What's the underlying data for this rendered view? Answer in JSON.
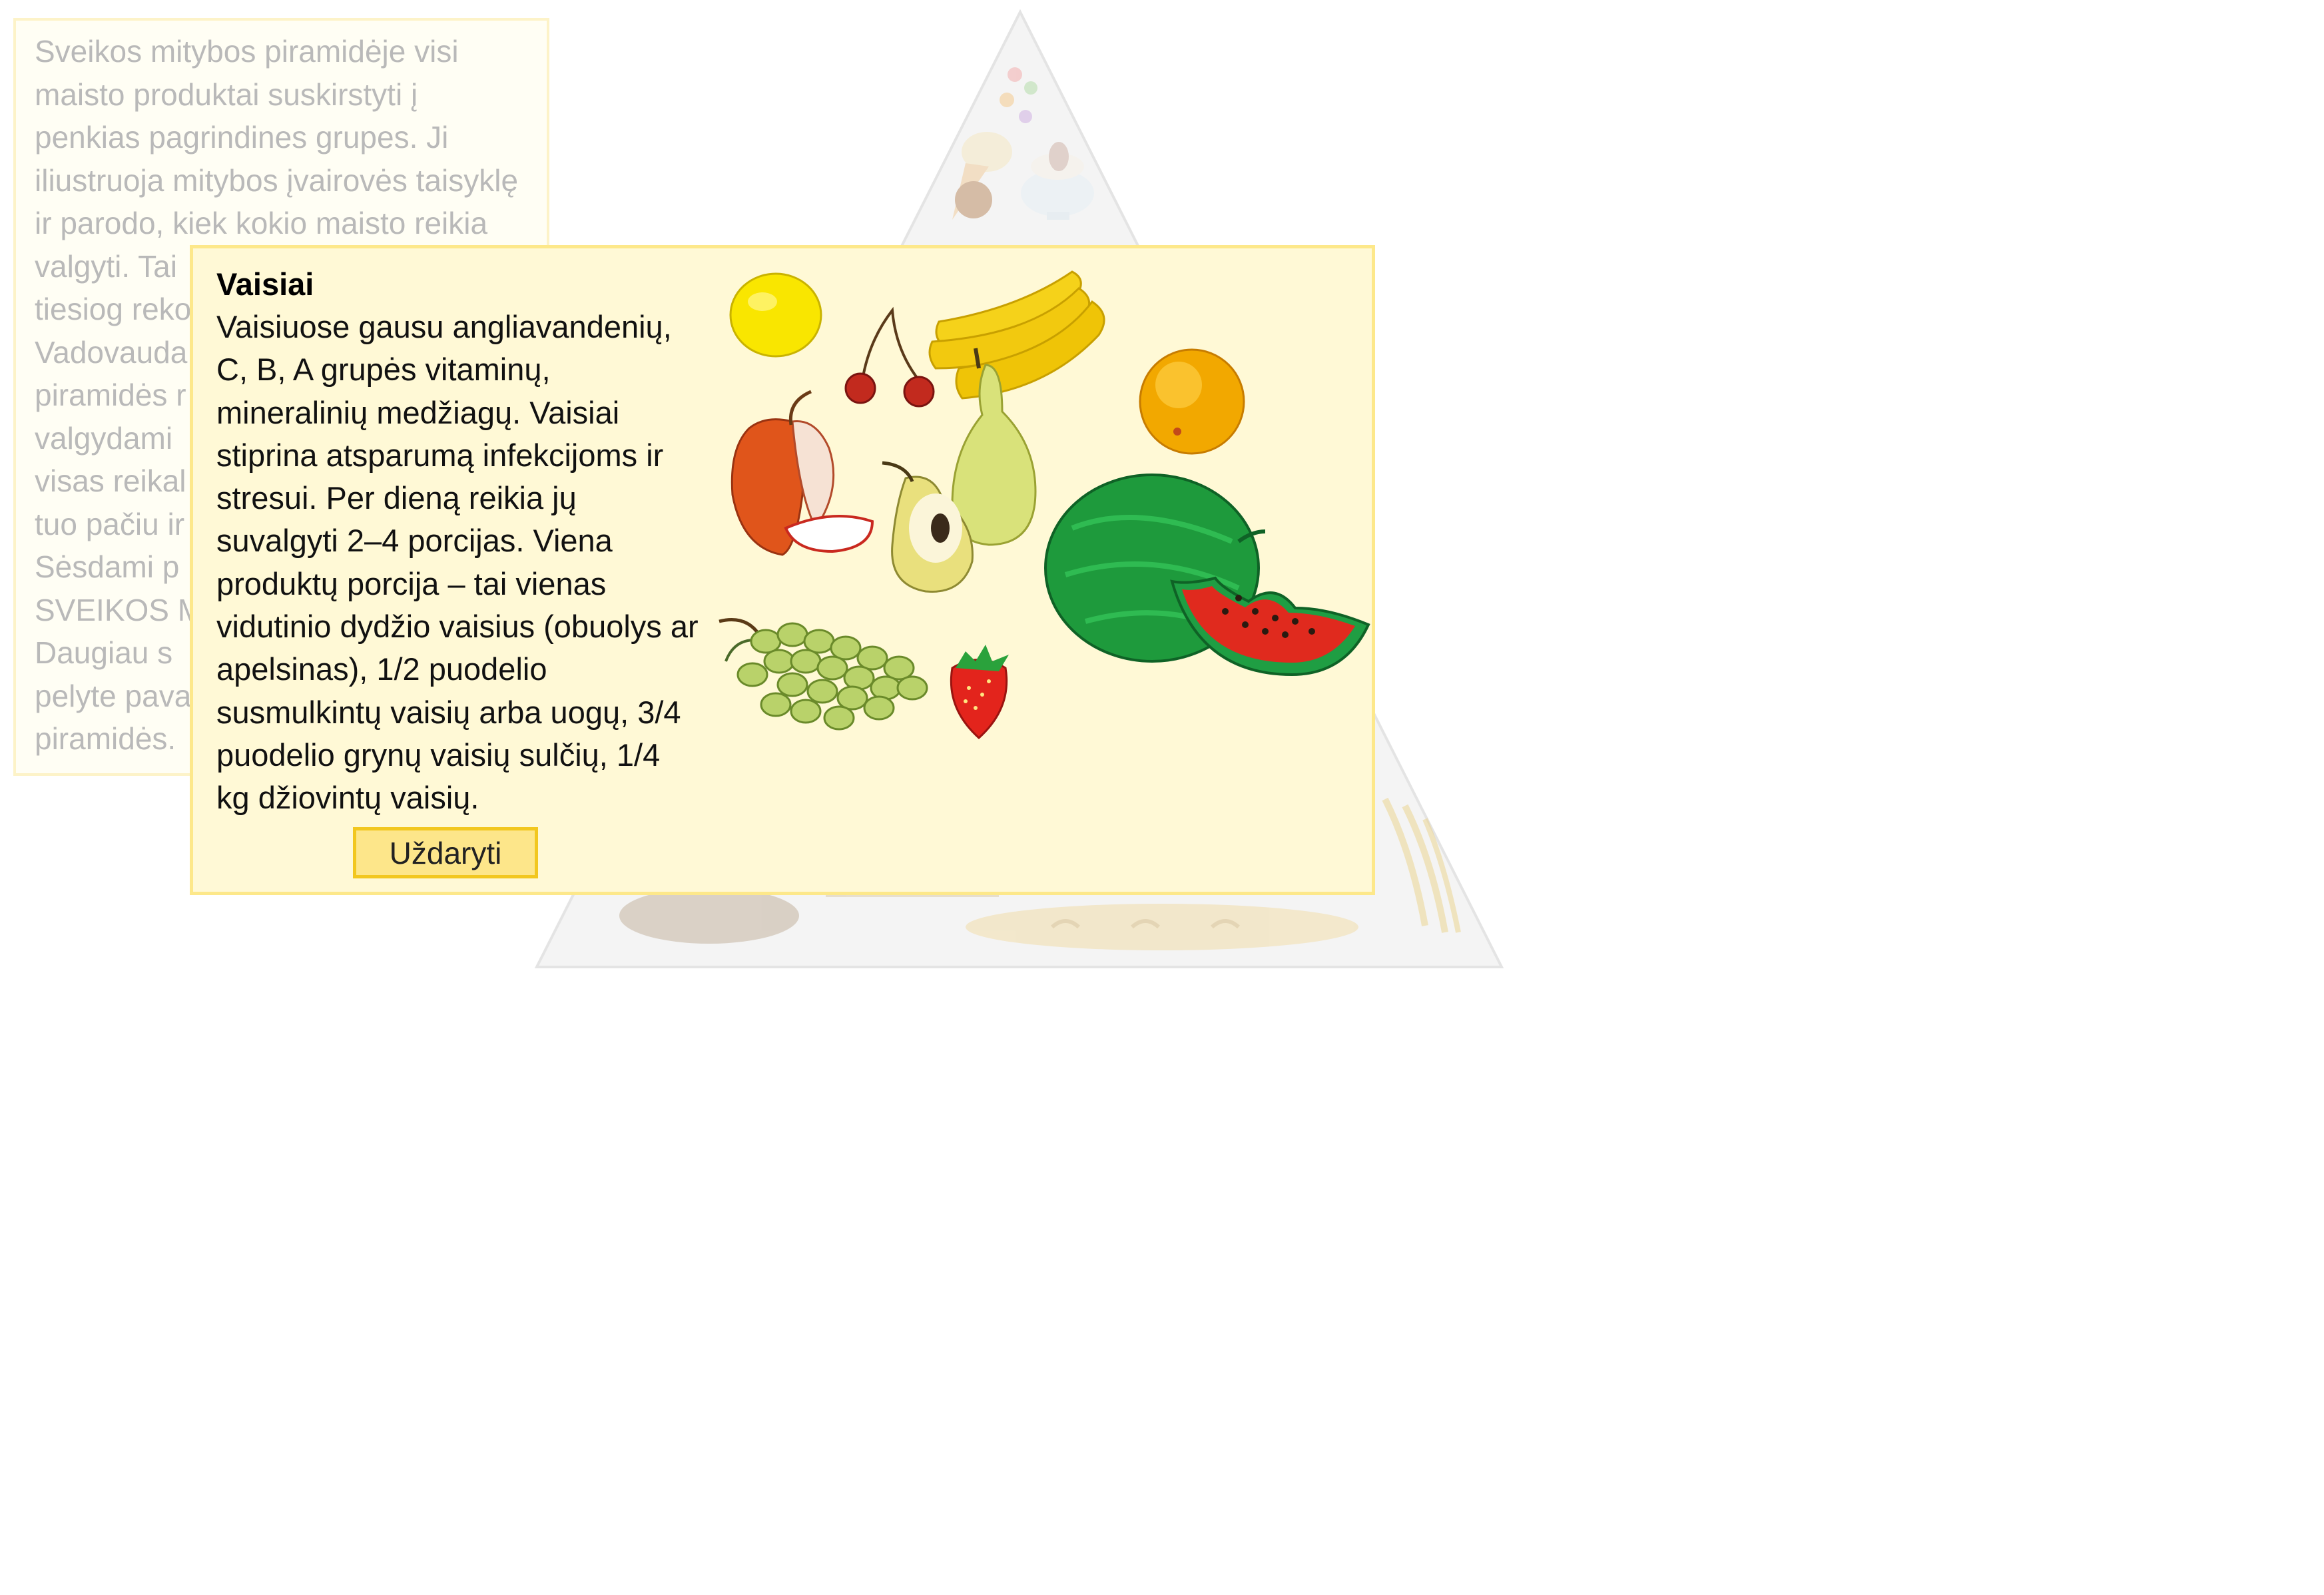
{
  "intro": {
    "lines": [
      "Sveikos mitybos piramidėje visi",
      "maisto produktai suskirstyti į",
      "penkias pagrindines grupes. Ji",
      "iliustruoja mitybos įvairovės taisyklę",
      "ir parodo, kiek kokio maisto reikia",
      "valgyti. Tai",
      "tiesiog reko",
      "Vadovauda",
      "piramidės r",
      "valgydami",
      "visas reikal",
      "tuo pačiu ir",
      "Sėsdami p",
      "SVEIKOS M",
      "Daugiau  s",
      "pelyte pava",
      "piramidės."
    ]
  },
  "dialog": {
    "title": "Vaisiai",
    "body": "Vaisiuose gausu angliavandenių, C,  B,  A grupės vitaminų, mineralinių medžiagų. Vaisiai stiprina atsparumą infekcijoms ir stresui. Per dieną reikia jų suvalgyti 2–4 porcijas. Viena produktų porcija – tai vienas vidutinio dydžio vaisius (obuolys ar apelsinas), 1/2 puodelio susmulkintų vaisių arba uogų, 3/4 puodelio grynų vaisių sulčių, 1/4 kg džiovintų vaisių.",
    "close_label": "Uždaryti"
  },
  "colors": {
    "dialog_bg": "#fff9d6",
    "dialog_border": "#fde88a",
    "button_bg": "#fde68a",
    "button_border": "#f2c71f"
  }
}
